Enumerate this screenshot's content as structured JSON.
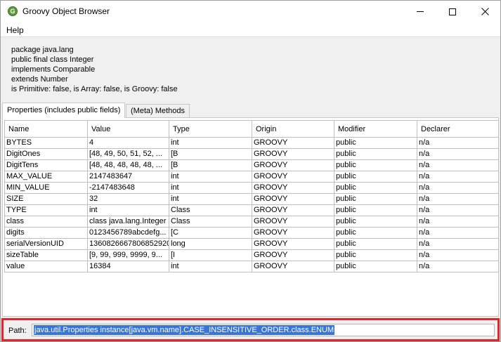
{
  "window": {
    "title": "Groovy Object Browser",
    "icon": "groovy-logo-icon",
    "icon_letter": "G"
  },
  "menu": {
    "help": "Help"
  },
  "info_lines": [
    "package java.lang",
    "public final class Integer",
    "implements Comparable",
    "extends Number",
    "is Primitive: false, is Array: false, is Groovy: false"
  ],
  "tabs": [
    {
      "label": "Properties (includes public fields)",
      "selected": true
    },
    {
      "label": "(Meta) Methods",
      "selected": false
    }
  ],
  "table": {
    "columns": [
      "Name",
      "Value",
      "Type",
      "Origin",
      "Modifier",
      "Declarer"
    ],
    "rows": [
      [
        "BYTES",
        "4",
        "int",
        "GROOVY",
        "public",
        "n/a"
      ],
      [
        "DigitOnes",
        "[48, 49, 50, 51, 52, ...",
        "[B",
        "GROOVY",
        "public",
        "n/a"
      ],
      [
        "DigitTens",
        "[48, 48, 48, 48, 48, ...",
        "[B",
        "GROOVY",
        "public",
        "n/a"
      ],
      [
        "MAX_VALUE",
        "2147483647",
        "int",
        "GROOVY",
        "public",
        "n/a"
      ],
      [
        "MIN_VALUE",
        "-2147483648",
        "int",
        "GROOVY",
        "public",
        "n/a"
      ],
      [
        "SIZE",
        "32",
        "int",
        "GROOVY",
        "public",
        "n/a"
      ],
      [
        "TYPE",
        "int",
        "Class",
        "GROOVY",
        "public",
        "n/a"
      ],
      [
        "class",
        "class java.lang.Integer",
        "Class",
        "GROOVY",
        "public",
        "n/a"
      ],
      [
        "digits",
        "0123456789abcdefg...",
        "[C",
        "GROOVY",
        "public",
        "n/a"
      ],
      [
        "serialVersionUID",
        "1360826667806852920",
        "long",
        "GROOVY",
        "public",
        "n/a"
      ],
      [
        "sizeTable",
        "[9, 99, 999, 9999, 9...",
        "[I",
        "GROOVY",
        "public",
        "n/a"
      ],
      [
        "value",
        "16384",
        "int",
        "GROOVY",
        "public",
        "n/a"
      ]
    ]
  },
  "path": {
    "label": "Path:",
    "value": "java.util.Properties instance[java.vm.name].CASE_INSENSITIVE_ORDER.class.ENUM"
  },
  "colors": {
    "highlight_border": "#e3242b",
    "selection": "#3875d7"
  }
}
